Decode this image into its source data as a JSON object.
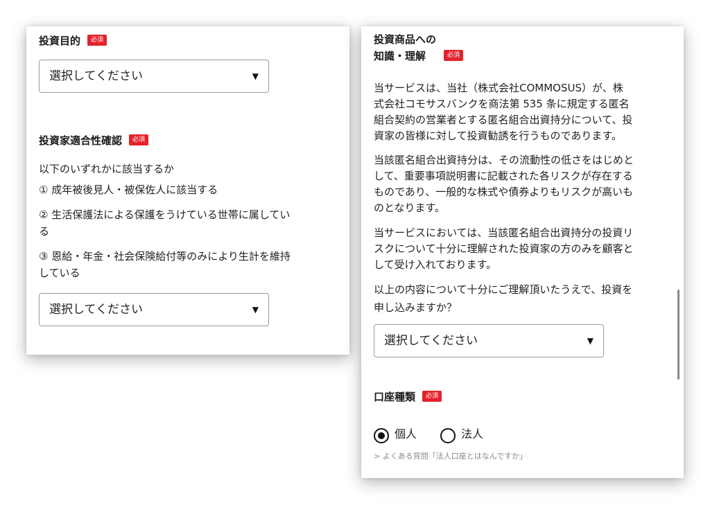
{
  "left": {
    "investment_purpose": {
      "label": "投資目的",
      "required": "必須",
      "select_value": "選択してください",
      "arrow": "▼"
    },
    "suitability": {
      "label": "投資家適合性確認",
      "required": "必須",
      "question": "以下のいずれかに該当するか",
      "items": [
        "① 成年被後見人・被保佐人に該当する",
        "② 生活保護法による保護をうけている世帯に属してい",
        "る",
        "③ 恩給・年金・社会保険給付等のみにより生計を維持",
        "している"
      ],
      "select_value": "選択してください",
      "arrow": "▼"
    }
  },
  "right": {
    "knowledge": {
      "label_line1": "投資商品への",
      "label_line2": "知識・理解",
      "required": "必須",
      "paragraphs": [
        [
          "当サービスは、当社（株式会社COMMOSUS）が、株",
          "式会社コモサスバンクを商法第 535 条に規定する匿名",
          "組合契約の営業者とする匿名組合出資持分について、投",
          "資家の皆様に対して投資勧誘を行うものであります。"
        ],
        [
          "当該匿名組合出資持分は、その流動性の低さをはじめと",
          "して、重要事項説明書に記載された各リスクが存在する",
          "ものであり、一般的な株式や債券よりもリスクが高いも",
          "のとなります。"
        ],
        [
          "当サービスにおいては、当該匿名組合出資持分の投資リ",
          "スクについて十分に理解された投資家の方のみを顧客と",
          "して受け入れております。"
        ],
        [
          "以上の内容について十分にご理解頂いたうえで、投資を",
          "申し込みますか？"
        ]
      ],
      "select_value": "選択してください",
      "arrow": "▼"
    },
    "account_type": {
      "label": "口座種類",
      "required": "必須",
      "options": [
        "個人",
        "法人"
      ],
      "selected": "個人",
      "faq_link": "> よくある質問「法人口座とはなんですか」"
    }
  }
}
